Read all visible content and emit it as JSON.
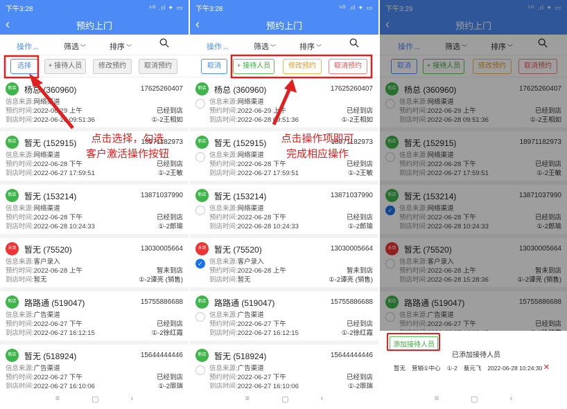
{
  "common": {
    "page_title": "预约上门",
    "tab_operate": "操作",
    "tab_filter": "筛选",
    "tab_sort": "排序",
    "source_label": "信息来源:",
    "reserve_label": "预约时间:",
    "arrive_label": "到店时间:",
    "badge_new": "新店",
    "badge_unvisited": "未到"
  },
  "screens": [
    {
      "time": "下午3:28",
      "signal": "⁵ᴳ .ıl ✦ ▭"
    },
    {
      "time": "下午3:28",
      "signal": "⁵ᴳ .ıl ✦ ▭"
    },
    {
      "time": "下午3:29",
      "signal": "⁵ᴳ .ıl ✦ ▭"
    }
  ],
  "buttons": {
    "select": "选择",
    "cancel": "取消",
    "add_staff": "+ 接待人员",
    "edit": "修改预约",
    "cancel_reservation": "取消预约"
  },
  "annotations": {
    "left": "点击选择，勾选\n客户激活操作按钮",
    "middle": "点击操作项即可\n完成相应操作"
  },
  "customers": [
    {
      "name": "杨总 (360960)",
      "phone": "17625260407",
      "source": "网络渠道",
      "reserve": "2022-06-29 上午",
      "status": "已经到店",
      "arrive": "2022-06-28 09:51:36",
      "staff": "①-2王相如",
      "badge": "new"
    },
    {
      "name": "暂无 (152915)",
      "phone": "18971182973",
      "source": "网络渠道",
      "reserve": "2022-06-28 下午",
      "status": "已经到店",
      "arrive": "2022-06-27 17:59:51",
      "staff": "①-2王敏",
      "badge": "new"
    },
    {
      "name": "暂无 (153214)",
      "phone": "13871037990",
      "source": "网络渠道",
      "reserve": "2022-06-28 下午",
      "status": "已经到店",
      "arrive": "2022-06-28 10:24:33",
      "staff": "①-2郎瑜",
      "badge": "new"
    },
    {
      "name": "暂无 (75520)",
      "phone": "13030005664",
      "source": "客户录入",
      "reserve": "2022-06-28 上午",
      "status": "暂未到店",
      "arrive": "暂无",
      "staff": "①-2谭亮 (销售)",
      "badge": "unvisited"
    },
    {
      "name": "路路通 (519047)",
      "phone": "15755886688",
      "source": "广告渠道",
      "reserve": "2022-06-27 下午",
      "status": "已经到店",
      "arrive": "2022-06-27 16:12:15",
      "staff": "①-2徐红霞",
      "badge": "new"
    },
    {
      "name": "暂无 (518924)",
      "phone": "15644444446",
      "source": "广告渠道",
      "reserve": "2022-06-27 下午",
      "status": "已经到店",
      "arrive": "2022-06-27 16:10:06",
      "staff": "①-2周瑞",
      "badge": "new"
    }
  ],
  "screen3_overrides": {
    "row4_arrive": "2022-06-28 15:28:36"
  },
  "panel": {
    "add_button": "添加接待人员",
    "added_title": "已添加接待人员",
    "record": [
      "暂无",
      "营销①中心",
      "①-2",
      "蔡元飞",
      "2022-06-28 10:24:30"
    ],
    "remove": "✕"
  },
  "nav": {
    "menu": "≡",
    "home": "▢",
    "back": "‹"
  },
  "colors": {
    "primary": "#4c8bf5",
    "annotation": "#e02020",
    "badge_green": "#3fb44a",
    "badge_red": "#ee3333"
  }
}
